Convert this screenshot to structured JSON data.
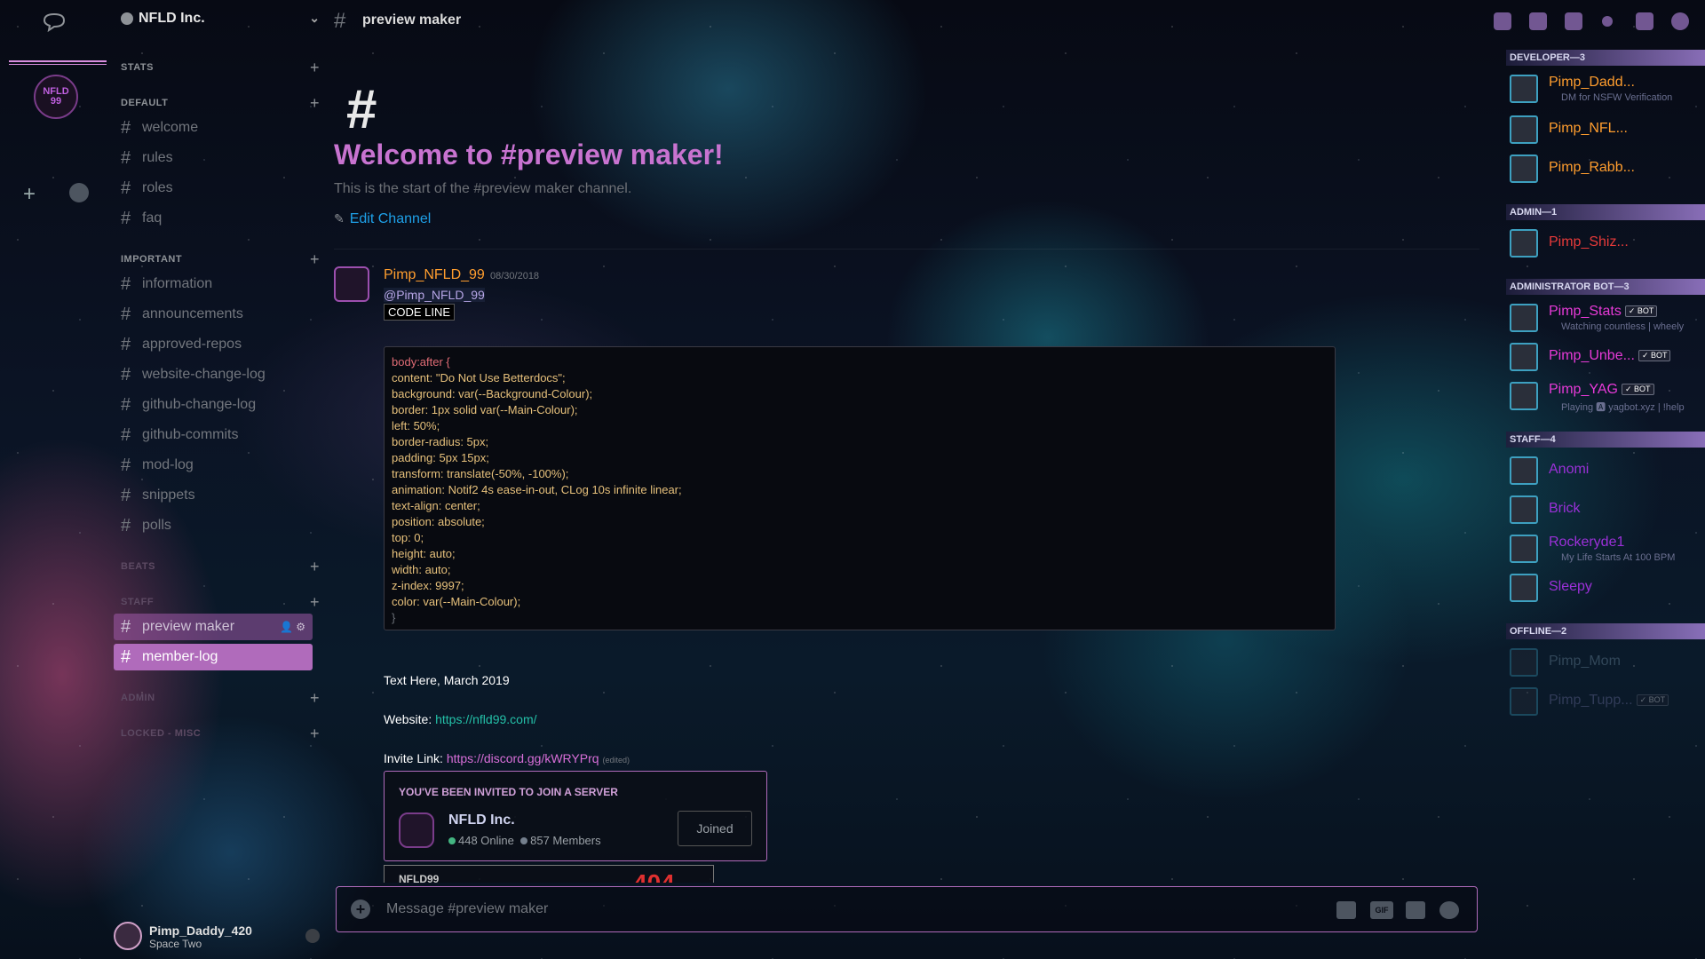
{
  "app": {
    "server_name": "NFLD Inc.",
    "channel_title": "preview maker"
  },
  "server_rail": {
    "server_icon_label": "NFLD 99",
    "add_label": "+"
  },
  "sidebar": {
    "categories": [
      {
        "name": "STATS",
        "channels": []
      },
      {
        "name": "DEFAULT",
        "channels": [
          "welcome",
          "rules",
          "roles",
          "faq"
        ]
      },
      {
        "name": "IMPORTANT",
        "channels": [
          "information",
          "announcements",
          "approved-repos",
          "website-change-log",
          "github-change-log",
          "github-commits",
          "mod-log",
          "snippets",
          "polls"
        ]
      },
      {
        "name": "BEATS",
        "channels": []
      },
      {
        "name": "STAFF",
        "channels": [
          "preview maker",
          "member-log"
        ]
      },
      {
        "name": "ADMIN",
        "channels": []
      },
      {
        "name": "LOCKED - MISC",
        "channels": []
      }
    ],
    "user": {
      "name": "Pimp_Daddy_420",
      "status": "Space Two"
    }
  },
  "channel": {
    "welcome_title": "Welcome to #preview maker!",
    "welcome_sub": "This is the start of the #preview maker channel.",
    "edit_label": "Edit Channel"
  },
  "message": {
    "author": "Pimp_NFLD_99",
    "timestamp": "08/30/2018",
    "mention": "@Pimp_NFLD_99",
    "code_tag": "CODE LINE",
    "code_lines": [
      "body:after {",
      "content: \"Do Not Use Betterdocs\";",
      "background: var(--Background-Colour);",
      "border: 1px solid var(--Main-Colour);",
      "left: 50%;",
      "border-radius: 5px;",
      "padding: 5px 15px;",
      "transform: translate(-50%, -100%);",
      "animation: Notif2 4s ease-in-out, CLog 10s infinite linear;",
      "text-align: center;",
      "position: absolute;",
      "top: 0;",
      "height: auto;",
      "width: auto;",
      "z-index: 9997;",
      "color: var(--Main-Colour);",
      "}"
    ],
    "text_line": "Text Here, March 2019",
    "website_label": "Website:",
    "website_url": "https://nfld99.com/",
    "invite_label": "Invite Link:",
    "invite_url": "https://discord.gg/kWRYPrq",
    "edited": "(edited)"
  },
  "invite_embed": {
    "heading": "YOU'VE BEEN INVITED TO JOIN A SERVER",
    "server_name": "NFLD Inc.",
    "online": "448 Online",
    "members": "857 Members",
    "button": "Joined",
    "peek_label": "NFLD99",
    "peek_number": "404"
  },
  "composer": {
    "placeholder": "Message #preview maker",
    "gif_label": "GIF"
  },
  "members": {
    "groups": [
      {
        "title": "DEVELOPER—3",
        "members": [
          {
            "name": "Pimp_Dadd...",
            "sub": "DM for NSFW Verification",
            "color": "#ff9d2e"
          },
          {
            "name": "Pimp_NFL...",
            "sub": "",
            "color": "#ff9d2e"
          },
          {
            "name": "Pimp_Rabb...",
            "sub": "",
            "color": "#ff9d2e"
          }
        ]
      },
      {
        "title": "ADMIN—1",
        "members": [
          {
            "name": "Pimp_Shiz...",
            "sub": "",
            "color": "#e83a3a"
          }
        ]
      },
      {
        "title": "ADMINISTRATOR BOT—3",
        "members": [
          {
            "name": "Pimp_Stats",
            "sub": "Watching countless | wheely",
            "color": "#e83ad8",
            "bot": "✓ BOT"
          },
          {
            "name": "Pimp_Unbe...",
            "sub": "",
            "color": "#e83ad8",
            "bot": "✓ BOT"
          },
          {
            "name": "Pimp_YAG",
            "sub": "Playing 🅰 yagbot.xyz | !help",
            "color": "#e83ad8",
            "bot": "✓ BOT"
          }
        ]
      },
      {
        "title": "STAFF—4",
        "members": [
          {
            "name": "Anomi",
            "sub": "",
            "color": "#9b30d8"
          },
          {
            "name": "Brick",
            "sub": "",
            "color": "#9b30d8"
          },
          {
            "name": "Rockeryde1",
            "sub": "My Life Starts At 100 BPM",
            "color": "#9b30d8"
          },
          {
            "name": "Sleepy",
            "sub": "",
            "color": "#9b30d8"
          }
        ]
      },
      {
        "title": "OFFLINE—2",
        "members": [
          {
            "name": "Pimp_Mom",
            "sub": "",
            "color": "#7a9ab0"
          },
          {
            "name": "Pimp_Tupp...",
            "sub": "",
            "color": "#7a7ab0",
            "bot": "✓ BOT"
          }
        ]
      }
    ]
  },
  "colors": {
    "accent": "#b06bbb",
    "title": "#c873d0",
    "link": "#1ea0e8",
    "online": "#43b581"
  }
}
